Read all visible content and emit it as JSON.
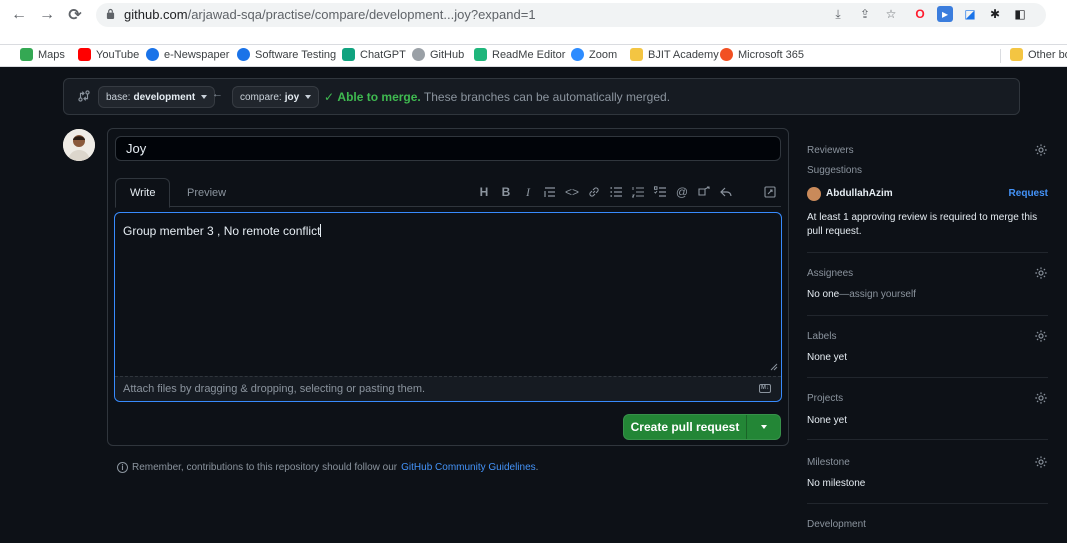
{
  "browser": {
    "url_host": "github.com",
    "url_path": "/arjawad-sqa/practise/compare/development...joy?expand=1",
    "bookmarks": [
      {
        "label": "Maps",
        "color": "#34a853"
      },
      {
        "label": "YouTube",
        "color": "#ff0000"
      },
      {
        "label": "e-Newspaper",
        "color": "#1a73e8"
      },
      {
        "label": "Software Testing",
        "color": "#1a73e8"
      },
      {
        "label": "ChatGPT",
        "color": "#10a37f"
      },
      {
        "label": "GitHub",
        "color": "#9aa0a6"
      },
      {
        "label": "ReadMe Editor",
        "color": "#1fb67b"
      },
      {
        "label": "Zoom",
        "color": "#2d8cff"
      },
      {
        "label": "BJIT Academy",
        "color": "#f4c542"
      },
      {
        "label": "Microsoft 365",
        "color": "#f25022"
      }
    ],
    "other_bookmarks": "Other bo"
  },
  "compare": {
    "base_prefix": "base:",
    "base_branch": "development",
    "compare_prefix": "compare:",
    "compare_branch": "joy",
    "merge_status": "Able to merge.",
    "merge_desc": "These branches can be automatically merged."
  },
  "form": {
    "title_value": "Joy",
    "tab_write": "Write",
    "tab_preview": "Preview",
    "body_value": "Group member 3 , No remote conflict",
    "attach_hint": "Attach files by dragging & dropping, selecting or pasting them.",
    "create_label": "Create pull request",
    "remember_prefix": "Remember, contributions to this repository should follow our",
    "remember_link": "GitHub Community Guidelines",
    "remember_suffix": "."
  },
  "sidebar": {
    "reviewers": {
      "heading": "Reviewers",
      "sub": "Suggestions",
      "reviewer": "AbdullahAzim",
      "request": "Request",
      "note": "At least 1 approving review is required to merge this pull request."
    },
    "assignees": {
      "heading": "Assignees",
      "value": "No one",
      "link": "—assign yourself"
    },
    "labels": {
      "heading": "Labels",
      "value": "None yet"
    },
    "projects": {
      "heading": "Projects",
      "value": "None yet"
    },
    "milestone": {
      "heading": "Milestone",
      "value": "No milestone"
    },
    "development": {
      "heading": "Development"
    }
  }
}
